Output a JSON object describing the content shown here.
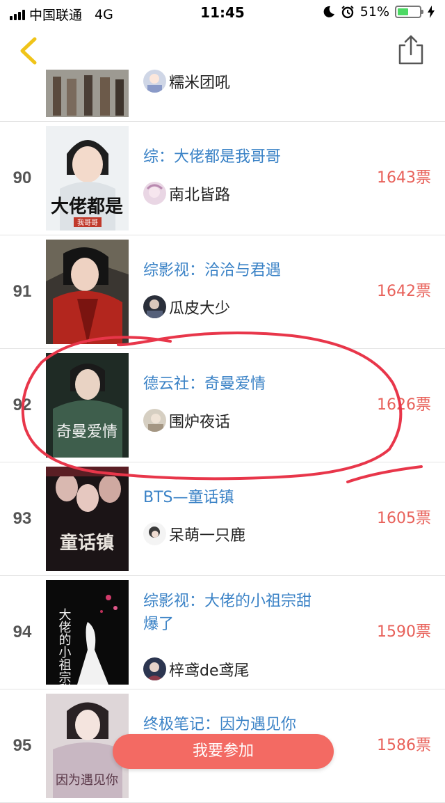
{
  "status_bar": {
    "carrier": "中国联通",
    "network": "4G",
    "time": "11:45",
    "battery_percent": "51%",
    "battery_level": 0.51
  },
  "nav": {
    "back_icon": "chevron-left-icon",
    "share_icon": "share-icon"
  },
  "colors": {
    "title": "#3a82c6",
    "votes": "#e8615a",
    "accent_button": "#f36a63",
    "annotation": "#e8364a"
  },
  "partial_row": {
    "author": "糯米团吼"
  },
  "rows": [
    {
      "rank": "90",
      "title": "综：大佬都是我哥哥",
      "author": "南北皆路",
      "votes": "1643票",
      "cover_text": "大佬都是",
      "cover_sub": "我哥哥"
    },
    {
      "rank": "91",
      "title": "综影视：洽洽与君遇",
      "author": "瓜皮大少",
      "votes": "1642票"
    },
    {
      "rank": "92",
      "title": "德云社：奇曼爱情",
      "author": "围炉夜话",
      "votes": "1626票",
      "cover_text": "奇曼爱情"
    },
    {
      "rank": "93",
      "title": "BTS—童话镇",
      "author": "呆萌一只鹿",
      "votes": "1605票",
      "cover_text": "童话镇"
    },
    {
      "rank": "94",
      "title": "综影视：大佬的小祖宗甜爆了",
      "author": "梓鸢de鸢尾",
      "votes": "1590票",
      "cover_text": "大佬的小祖宗甜爆了"
    },
    {
      "rank": "95",
      "title": "终极笔记：因为遇见你",
      "author": "",
      "votes": "1586票",
      "cover_text": "因为遇见你"
    }
  ],
  "join_button": "我要参加"
}
